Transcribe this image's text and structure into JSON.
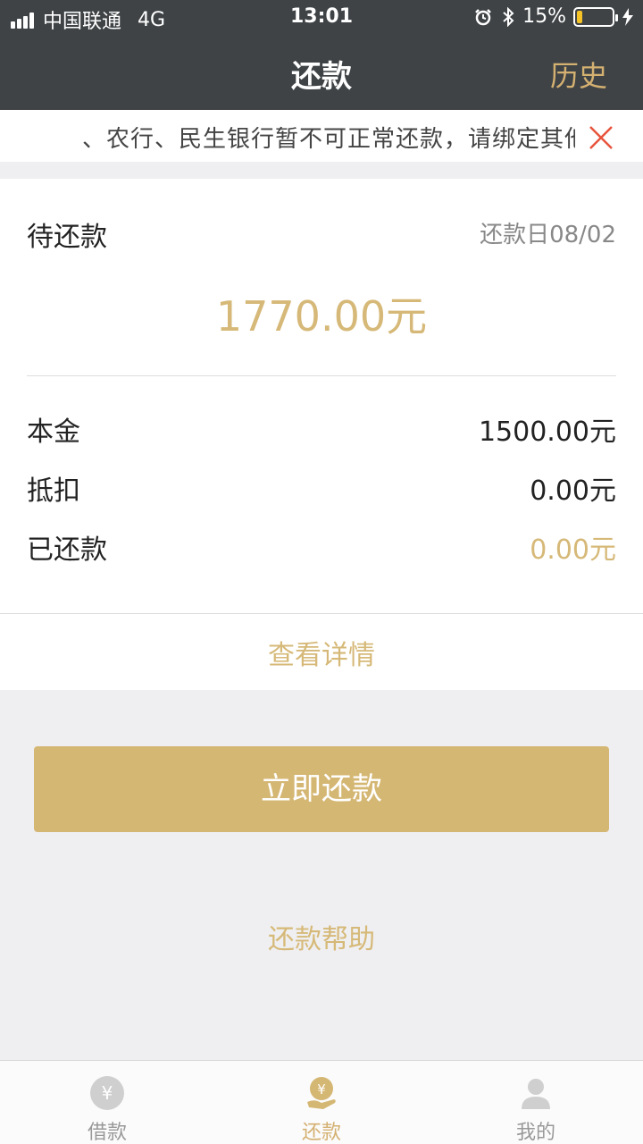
{
  "status_bar": {
    "carrier": "中国联通",
    "network": "4G",
    "time": "13:01",
    "battery": "15%",
    "battery_level": 0.15
  },
  "nav": {
    "title": "还款",
    "history": "历史"
  },
  "notice": {
    "text": "、农行、民生银行暂不可正常还款，请绑定其他",
    "close_icon": "close-icon"
  },
  "repayment": {
    "pending_label": "待还款",
    "due_date": "还款日08/02",
    "amount": "1770.00元",
    "rows": [
      {
        "label": "本金",
        "value": "1500.00元"
      },
      {
        "label": "抵扣",
        "value": "0.00元"
      },
      {
        "label": "已还款",
        "value": "0.00元"
      }
    ],
    "details_link": "查看详情"
  },
  "actions": {
    "pay_now": "立即还款",
    "help": "还款帮助"
  },
  "tabbar": {
    "items": [
      {
        "label": "借款",
        "icon": "yen-coin-icon"
      },
      {
        "label": "还款",
        "icon": "yen-hand-icon"
      },
      {
        "label": "我的",
        "icon": "user-icon"
      }
    ]
  },
  "colors": {
    "header_bg": "#3f4346",
    "accent_gold": "#d5b774",
    "close_red": "#e8533c"
  }
}
